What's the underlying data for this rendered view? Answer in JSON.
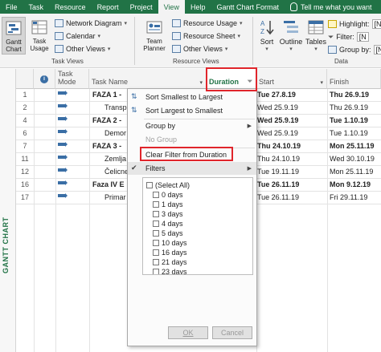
{
  "menubar": {
    "tabs": [
      "File",
      "Task",
      "Resource",
      "Report",
      "Project",
      "View",
      "Help",
      "Gantt Chart Format"
    ],
    "active": "View",
    "search_placeholder": "Tell me what you want"
  },
  "ribbon": {
    "gantt_chart_label": "Gantt Chart",
    "task_usage_label": "Task Usage",
    "network_diagram": "Network Diagram",
    "calendar": "Calendar",
    "other_views": "Other Views",
    "task_views_group": "Task Views",
    "team_planner": "Team Planner",
    "resource_usage": "Resource Usage",
    "resource_sheet": "Resource Sheet",
    "other_views_2": "Other Views",
    "resource_views_group": "Resource Views",
    "sort": "Sort",
    "outline": "Outline",
    "tables": "Tables",
    "highlight": "Highlight:",
    "filter": "Filter:",
    "group_by": "Group by:",
    "data_group": "Data",
    "highlight_value": "[N",
    "filter_value": "[N",
    "group_value": "[N"
  },
  "table": {
    "headers": {
      "mode": "Task Mode",
      "name": "Task Name",
      "duration": "Duration",
      "start": "Start",
      "finish": "Finish"
    },
    "side_label": "GANTT CHART",
    "rows": [
      {
        "id": "1",
        "name": "FAZA 1 -",
        "start": "Tue 27.8.19",
        "finish": "Thu 26.9.19",
        "bold": true
      },
      {
        "id": "2",
        "name": "Transp",
        "start": "Wed 25.9.19",
        "finish": "Thu 26.9.19",
        "bold": false
      },
      {
        "id": "4",
        "name": "FAZA 2 -",
        "start": "Wed 25.9.19",
        "finish": "Tue 1.10.19",
        "bold": true
      },
      {
        "id": "6",
        "name": "Demor",
        "start": "Wed 25.9.19",
        "finish": "Tue 1.10.19",
        "bold": false
      },
      {
        "id": "7",
        "name": "FAZA 3 -",
        "start": "Thu 24.10.19",
        "finish": "Mon 25.11.19",
        "bold": true
      },
      {
        "id": "11",
        "name": "Zemlja",
        "start": "Thu 24.10.19",
        "finish": "Wed 30.10.19",
        "bold": false
      },
      {
        "id": "12",
        "name": "Čelicne",
        "start": "Tue 19.11.19",
        "finish": "Mon 25.11.19",
        "bold": false
      },
      {
        "id": "16",
        "name": "Faza IV E",
        "start": "Tue 26.11.19",
        "finish": "Mon 9.12.19",
        "bold": true
      },
      {
        "id": "17",
        "name": "Primar",
        "start": "Tue 26.11.19",
        "finish": "Fri 29.11.19",
        "bold": false
      }
    ]
  },
  "menu": {
    "sort_asc": "Sort Smallest to Largest",
    "sort_desc": "Sort Largest to Smallest",
    "group_by": "Group by",
    "no_group": "No Group",
    "clear_filter": "Clear Filter from Duration",
    "filters": "Filters",
    "filter_items": [
      "(Select All)",
      "0 days",
      "1 days",
      "3 days",
      "4 days",
      "5 days",
      "10 days",
      "16 days",
      "21 days",
      "23 days"
    ],
    "ok": "OK",
    "cancel": "Cancel"
  },
  "colors": {
    "brand": "#217346",
    "annotation": "#e0252b"
  }
}
